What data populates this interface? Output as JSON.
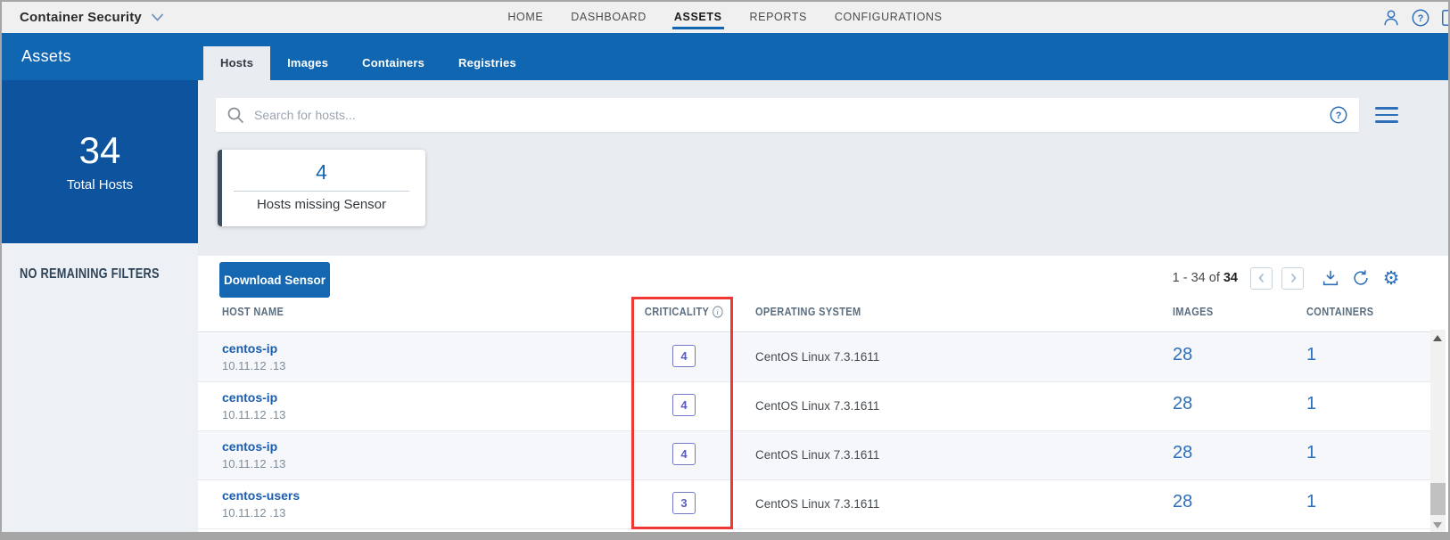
{
  "topbar": {
    "brand": "Container Security",
    "nav_items": [
      {
        "label": "HOME",
        "active": false
      },
      {
        "label": "DASHBOARD",
        "active": false
      },
      {
        "label": "ASSETS",
        "active": true
      },
      {
        "label": "REPORTS",
        "active": false
      },
      {
        "label": "CONFIGURATIONS",
        "active": false
      }
    ]
  },
  "appbar": {
    "title": "Assets",
    "tabs": [
      {
        "label": "Hosts",
        "active": true
      },
      {
        "label": "Images",
        "active": false
      },
      {
        "label": "Containers",
        "active": false
      },
      {
        "label": "Registries",
        "active": false
      }
    ]
  },
  "sidebar": {
    "total_value": "34",
    "total_label": "Total Hosts",
    "filters_text": "NO REMAINING FILTERS"
  },
  "search": {
    "placeholder": "Search for hosts..."
  },
  "summary_card": {
    "value": "4",
    "label": "Hosts missing Sensor"
  },
  "toolbar": {
    "download_label": "Download Sensor",
    "pagination_range": "1 - 34 of",
    "pagination_total": "34"
  },
  "table": {
    "headers": {
      "host": "HOST NAME",
      "criticality": "CRITICALITY",
      "os": "OPERATING SYSTEM",
      "images": "IMAGES",
      "containers": "CONTAINERS"
    },
    "rows": [
      {
        "host": "centos-ip",
        "ip": "10.11.12 .13",
        "criticality": "4",
        "os": "CentOS Linux 7.3.1611",
        "images": "28",
        "containers": "1"
      },
      {
        "host": "centos-ip",
        "ip": "10.11.12 .13",
        "criticality": "4",
        "os": "CentOS Linux 7.3.1611",
        "images": "28",
        "containers": "1"
      },
      {
        "host": "centos-ip",
        "ip": "10.11.12 .13",
        "criticality": "4",
        "os": "CentOS Linux 7.3.1611",
        "images": "28",
        "containers": "1"
      },
      {
        "host": "centos-users",
        "ip": "10.11.12 .13",
        "criticality": "3",
        "os": "CentOS Linux 7.3.1611",
        "images": "28",
        "containers": "1"
      }
    ]
  },
  "colors": {
    "appbar_blue": "#1166b1",
    "stat_blue": "#0e539e",
    "button_blue": "#1467b0",
    "link_blue": "#1b5dad",
    "value_blue": "#2e6fba",
    "badge_purple": "#7478c9",
    "highlight_red": "#ef3733"
  }
}
